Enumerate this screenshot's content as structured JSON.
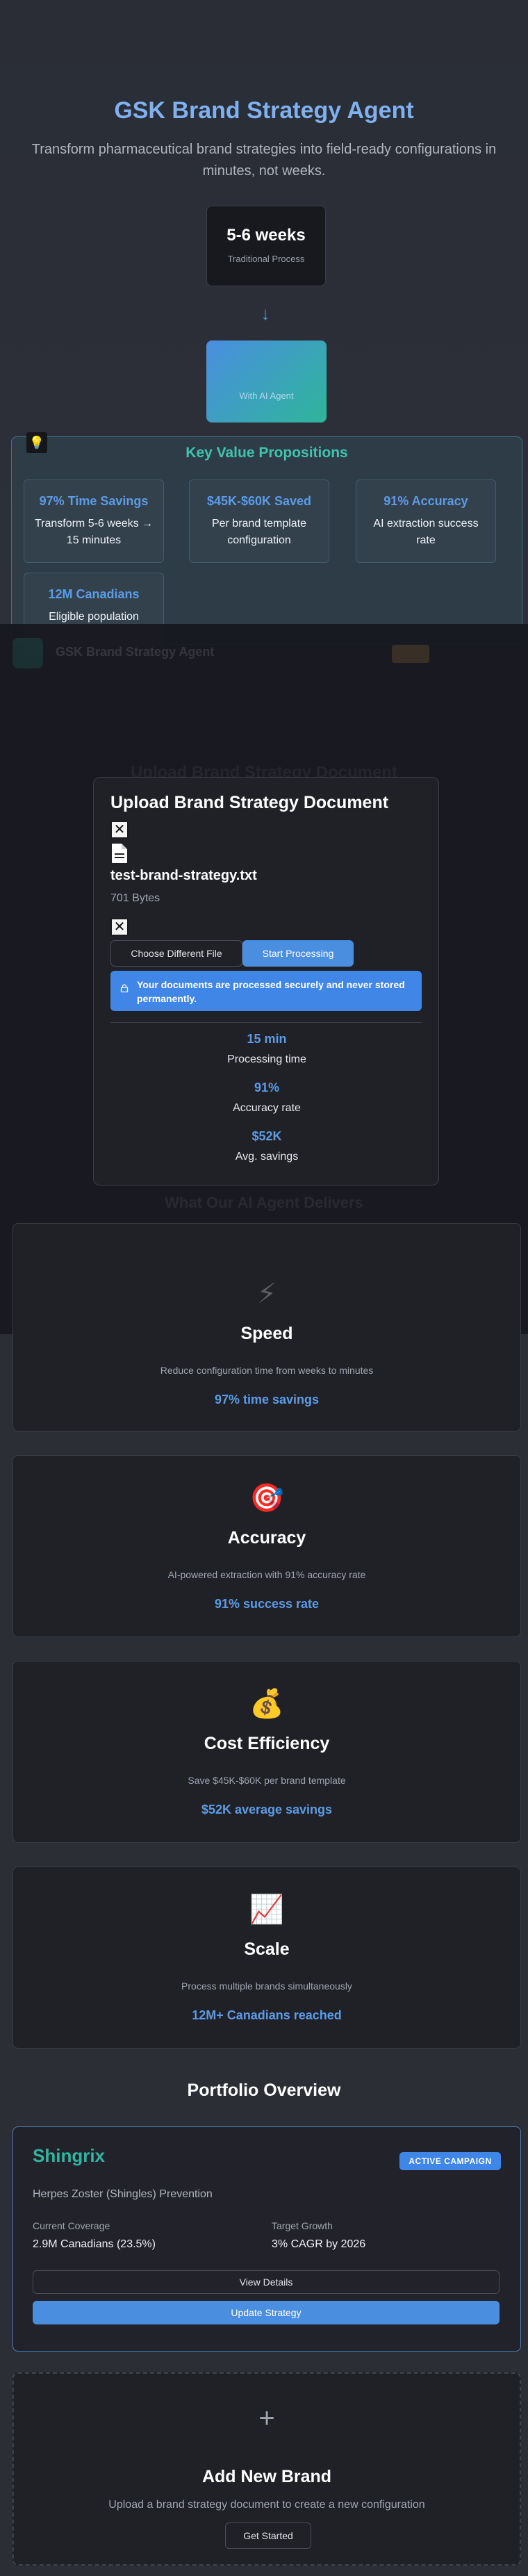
{
  "hero": {
    "title": "GSK Brand Strategy Agent",
    "subtitle": "Transform pharmaceutical brand strategies into field-ready configurations in minutes, not weeks.",
    "traditional": {
      "value": "5-6 weeks",
      "label": "Traditional Process"
    },
    "arrow_icon": "arrow-down-icon",
    "ai": {
      "label": "With AI Agent"
    }
  },
  "value_props": {
    "icon": "lightbulb-icon",
    "title": "Key Value Propositions",
    "cards": [
      {
        "headline": "97% Time Savings",
        "text": "Transform 5-6 weeks → 15 minutes"
      },
      {
        "headline": "$45K-$60K Saved",
        "text": "Per brand template configuration"
      },
      {
        "headline": "91% Accuracy",
        "text": "AI extraction success rate"
      },
      {
        "headline": "12M Canadians",
        "text": "Eligible population"
      }
    ]
  },
  "background": {
    "app_name": "GSK Brand Strategy Agent",
    "section_title": "Upload Brand Strategy Document",
    "section_subtitle": "What Our AI Agent Delivers"
  },
  "modal": {
    "title": "Upload Brand Strategy Document",
    "close_icon": "close-icon",
    "file_icon": "file-icon",
    "file_name": "test-brand-strategy.txt",
    "file_size": "701 Bytes",
    "remove_icon": "close-icon",
    "choose_label": "Choose Different File",
    "start_label": "Start Processing",
    "lock_icon": "lock-icon",
    "secure_text": "Your documents are processed securely and never stored permanently.",
    "stats": [
      {
        "value": "15 min",
        "label": "Processing time"
      },
      {
        "value": "91%",
        "label": "Accuracy rate"
      },
      {
        "value": "$52K",
        "label": "Avg. savings"
      }
    ]
  },
  "benefits": [
    {
      "icon": "lightning-icon",
      "glyph": "⚡",
      "title": "Speed",
      "desc": "Reduce configuration time from weeks to minutes",
      "highlight": "97% time savings"
    },
    {
      "icon": "target-icon",
      "glyph": "🎯",
      "title": "Accuracy",
      "desc": "AI-powered extraction with 91% accuracy rate",
      "highlight": "91% success rate"
    },
    {
      "icon": "money-bag-icon",
      "glyph": "💰",
      "title": "Cost Efficiency",
      "desc": "Save $45K-$60K per brand template",
      "highlight": "$52K average savings"
    },
    {
      "icon": "chart-up-icon",
      "glyph": "📈",
      "title": "Scale",
      "desc": "Process multiple brands simultaneously",
      "highlight": "12M+ Canadians reached"
    }
  ],
  "portfolio": {
    "title": "Portfolio Overview",
    "brand": {
      "name": "Shingrix",
      "badge": "ACTIVE CAMPAIGN",
      "description": "Herpes Zoster (Shingles) Prevention",
      "coverage_label": "Current Coverage",
      "coverage_value": "2.9M Canadians (23.5%)",
      "growth_label": "Target Growth",
      "growth_value": "3% CAGR by 2026",
      "details_label": "View Details",
      "update_label": "Update Strategy"
    },
    "add": {
      "icon": "plus-icon",
      "title": "Add New Brand",
      "desc": "Upload a brand strategy document to create a new configuration",
      "button": "Get Started"
    }
  },
  "colors": {
    "accent_blue": "#4a8ee0",
    "accent_teal": "#2fb5a3",
    "title_blue": "#7fb0ef"
  }
}
